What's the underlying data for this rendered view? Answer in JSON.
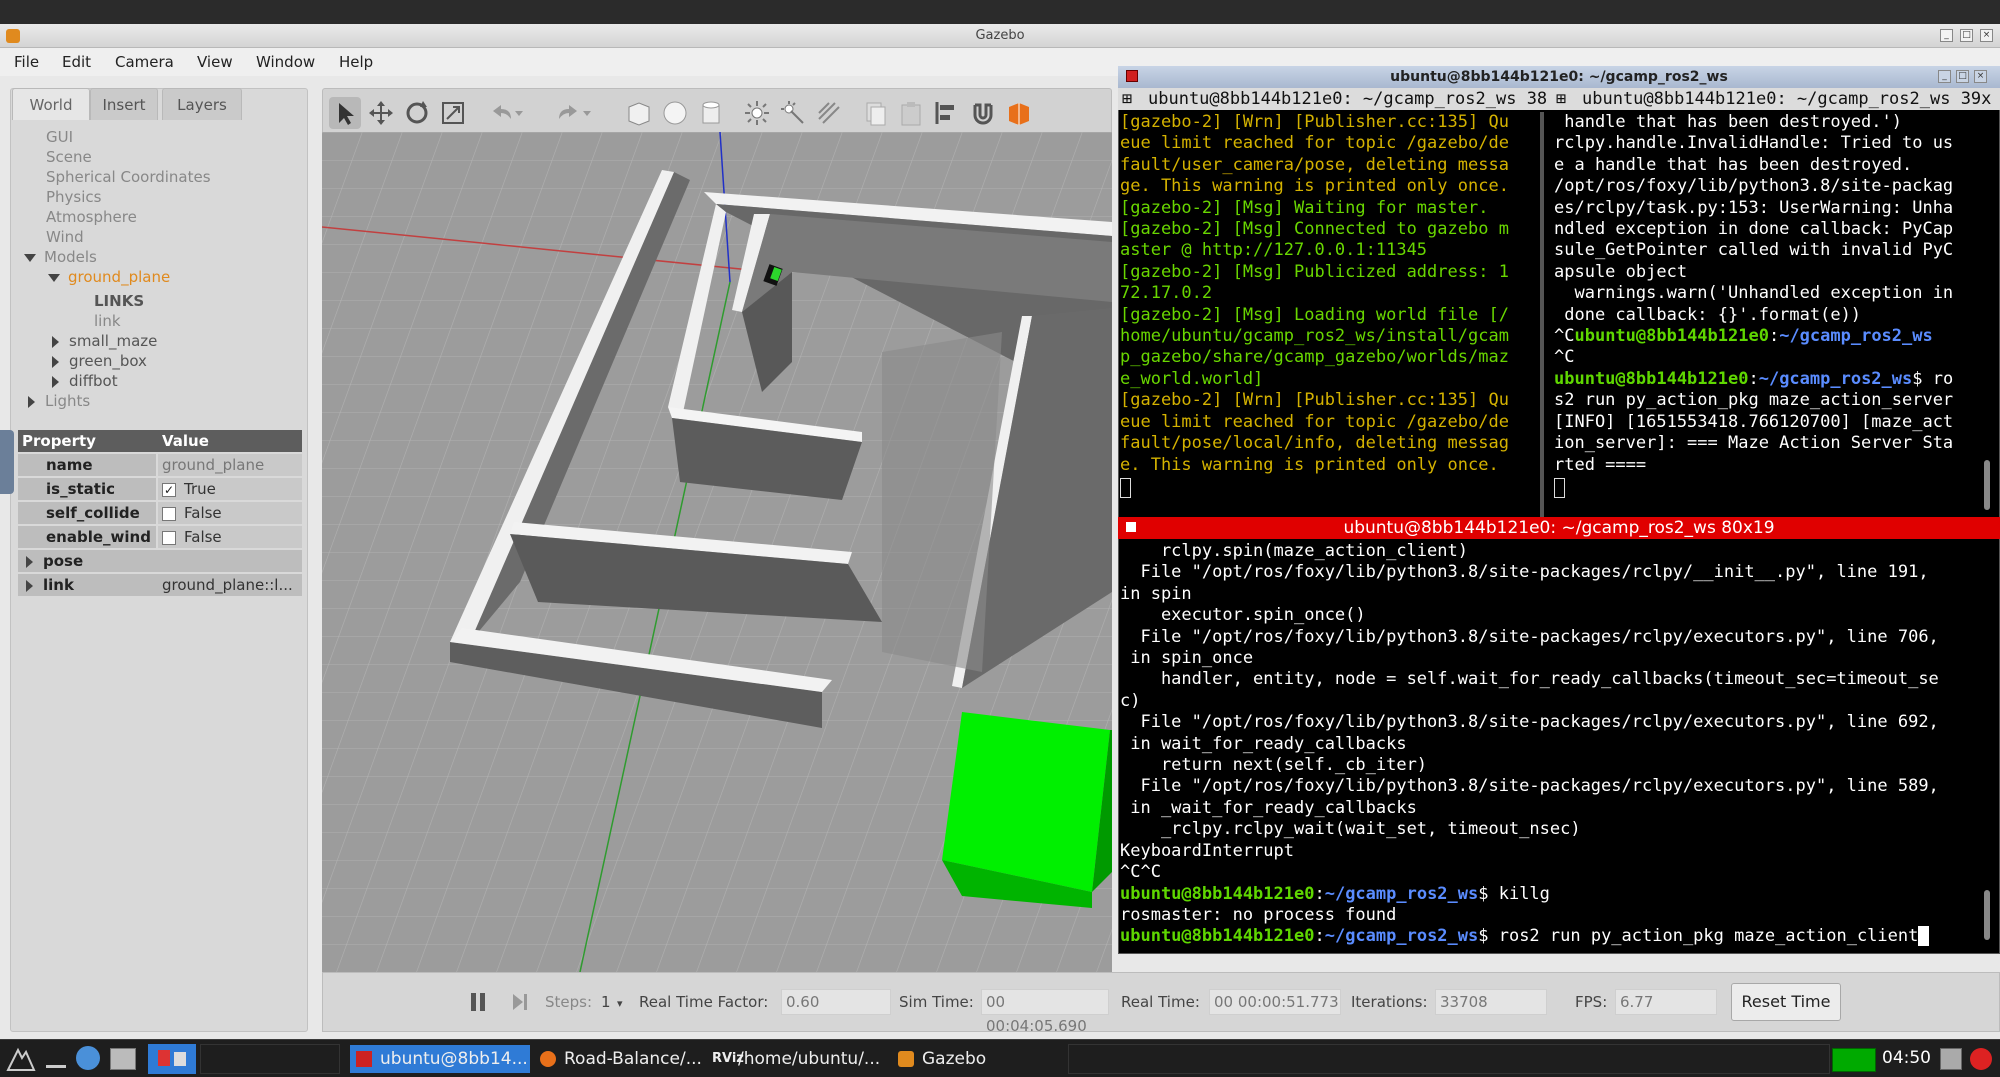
{
  "window": {
    "title": "Gazebo"
  },
  "menu": [
    "File",
    "Edit",
    "Camera",
    "View",
    "Window",
    "Help"
  ],
  "left_tabs": [
    "World",
    "Insert",
    "Layers"
  ],
  "tree": {
    "items": [
      "GUI",
      "Scene",
      "Spherical Coordinates",
      "Physics",
      "Atmosphere",
      "Wind"
    ],
    "models_label": "Models",
    "ground_plane": "ground_plane",
    "links_label": "LINKS",
    "link": "link",
    "small_maze": "small_maze",
    "green_box": "green_box",
    "diffbot": "diffbot",
    "lights": "Lights"
  },
  "properties": {
    "header": {
      "property": "Property",
      "value": "Value"
    },
    "rows": [
      {
        "key": "name",
        "value": "ground_plane"
      },
      {
        "key": "is_static",
        "value": "True",
        "checked": "✓"
      },
      {
        "key": "self_collide",
        "value": "False",
        "checked": ""
      },
      {
        "key": "enable_wind",
        "value": "False",
        "checked": ""
      },
      {
        "key": "pose",
        "value": ""
      },
      {
        "key": "link",
        "value": "ground_plane::l..."
      }
    ]
  },
  "bottom": {
    "steps_label": "Steps:",
    "steps_value": "1",
    "rtf_label": "Real Time Factor:",
    "rtf_value": "0.60",
    "sim_label": "Sim Time:",
    "sim_value": "00 00:04:05.690",
    "real_label": "Real Time:",
    "real_value": "00 00:00:51.773",
    "iter_label": "Iterations:",
    "iter_value": "33708",
    "fps_label": "FPS:",
    "fps_value": "6.77",
    "reset_label": "Reset Time"
  },
  "terminal": {
    "title": "ubuntu@8bb144b121e0: ~/gcamp_ros2_ws",
    "tab_left": "ubuntu@8bb144b121e0: ~/gcamp_ros2_ws 38",
    "tab_right": "ubuntu@8bb144b121e0: ~/gcamp_ros2_ws 39x",
    "bottom_title": "ubuntu@8bb144b121e0: ~/gcamp_ros2_ws 80x19",
    "left_lines": [
      "[gazebo-2] [Wrn] [Publisher.cc:135] Qu",
      "eue limit reached for topic /gazebo/de",
      "fault/user_camera/pose, deleting messa",
      "ge. This warning is printed only once.",
      "[gazebo-2] [Msg] Waiting for master.",
      "[gazebo-2] [Msg] Connected to gazebo m",
      "aster @ http://127.0.0.1:11345",
      "[gazebo-2] [Msg] Publicized address: 1",
      "72.17.0.2",
      "[gazebo-2] [Msg] Loading world file [/",
      "home/ubuntu/gcamp_ros2_ws/install/gcam",
      "p_gazebo/share/gcamp_gazebo/worlds/maz",
      "e_world.world]",
      "[gazebo-2] [Wrn] [Publisher.cc:135] Qu",
      "eue limit reached for topic /gazebo/de",
      "fault/pose/local/info, deleting messag",
      "e. This warning is printed only once."
    ],
    "right_lines": [
      " handle that has been destroyed.')",
      "rclpy.handle.InvalidHandle: Tried to us",
      "e a handle that has been destroyed.",
      "/opt/ros/foxy/lib/python3.8/site-packag",
      "es/rclpy/task.py:153: UserWarning: Unha",
      "ndled exception in done callback: PyCap",
      "sule_GetPointer called with invalid PyC",
      "apsule object",
      "  warnings.warn('Unhandled exception in",
      " done callback: {}'.format(e))"
    ],
    "right_prompt_ctrl": "^C",
    "prompt_user": "ubuntu@8bb144b121e0",
    "prompt_path": "~/gcamp_ros2_ws",
    "right_cmd_1": "$ ro",
    "right_cmd_2": "s2 run py_action_pkg maze_action_server",
    "right_info": [
      "[INFO] [1651553418.766120700] [maze_act",
      "ion_server]: === Maze Action Server Sta",
      "rted ===="
    ],
    "bottom_lines": [
      "    rclpy.spin(maze_action_client)",
      "  File \"/opt/ros/foxy/lib/python3.8/site-packages/rclpy/__init__.py\", line 191,",
      "in spin",
      "    executor.spin_once()",
      "  File \"/opt/ros/foxy/lib/python3.8/site-packages/rclpy/executors.py\", line 706,",
      " in spin_once",
      "    handler, entity, node = self.wait_for_ready_callbacks(timeout_sec=timeout_se",
      "c)",
      "  File \"/opt/ros/foxy/lib/python3.8/site-packages/rclpy/executors.py\", line 692,",
      " in wait_for_ready_callbacks",
      "    return next(self._cb_iter)",
      "  File \"/opt/ros/foxy/lib/python3.8/site-packages/rclpy/executors.py\", line 589,",
      " in _wait_for_ready_callbacks",
      "    _rclpy.rclpy_wait(wait_set, timeout_nsec)",
      "KeyboardInterrupt",
      "^C^C"
    ],
    "cmd_killg": "$ killg",
    "rosmaster_line": "rosmaster: no process found",
    "cmd_last": "$ ros2 run py_action_pkg maze_action_client"
  },
  "taskbar": {
    "items": [
      "ubuntu@8bb14...",
      "Road-Balance/...",
      "/home/ubuntu/...",
      "Gazebo"
    ],
    "clock": "04:50"
  },
  "colors": {
    "accent": "#2f7bd6",
    "green_box": "#00ff00",
    "terminal_red": "#e00000",
    "orange": "#e08a1e"
  }
}
